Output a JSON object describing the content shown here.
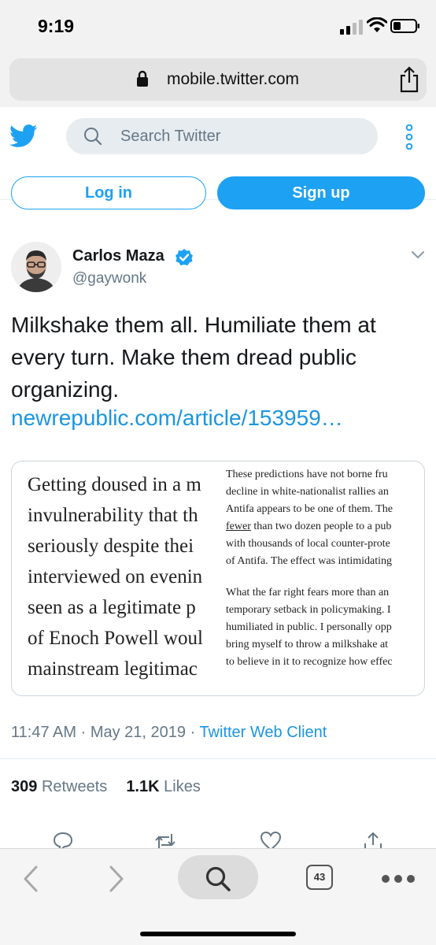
{
  "status_bar": {
    "time": "9:19"
  },
  "browser": {
    "url": "mobile.twitter.com",
    "tab_count": "43"
  },
  "header": {
    "search_placeholder": "Search Twitter",
    "login_label": "Log in",
    "signup_label": "Sign up"
  },
  "tweet": {
    "author_name": "Carlos Maza",
    "author_handle": "@gaywonk",
    "text": "Milkshake them all. Humiliate them at every turn. Make them dread public organizing.",
    "link": "newrepublic.com/article/153959…",
    "media_left_lines": [
      "Getting doused in a m",
      "invulnerability that th",
      "seriously despite thei",
      "interviewed on evenin",
      "seen as a legitimate p",
      "of Enoch Powell woul",
      "mainstream legitimac"
    ],
    "media_right_para1": [
      "These predictions have not borne fru",
      "decline in white-nationalist rallies an",
      "Antifa appears to be one of them. The",
      "fewer than two dozen people to a pub",
      "with thousands of local counter-prote",
      "of Antifa. The effect was intimidating"
    ],
    "media_right_para2": [
      "What the far right fears more than an",
      "temporary setback in policymaking. I",
      "humiliated in public. I personally opp",
      "bring myself to throw a milkshake at",
      "to believe in it to recognize how effec"
    ],
    "time": "11:47 AM",
    "date": "May 21, 2019",
    "client": "Twitter Web Client",
    "retweets_count": "309",
    "retweets_label": "Retweets",
    "likes_count": "1.1K",
    "likes_label": "Likes"
  },
  "colors": {
    "twitter_blue": "#1da1f2",
    "link_blue": "#1b95e0",
    "muted": "#657786"
  },
  "icons": [
    "lock-icon",
    "share-icon",
    "twitter-bird-icon",
    "search-icon",
    "more-vertical-icon",
    "verified-icon",
    "chevron-down-icon",
    "reply-icon",
    "retweet-icon",
    "like-icon",
    "share-tweet-icon",
    "back-icon",
    "forward-icon",
    "tabs-icon",
    "more-horizontal-icon"
  ]
}
